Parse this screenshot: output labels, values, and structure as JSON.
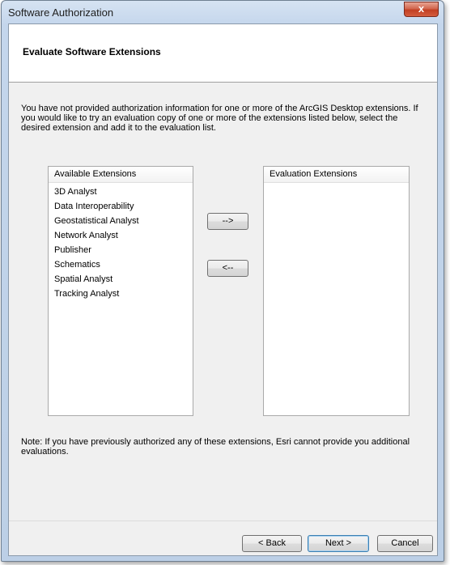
{
  "window": {
    "title": "Software Authorization",
    "close_glyph": "x"
  },
  "header": {
    "title": "Evaluate Software Extensions"
  },
  "intro_text": "You have not provided authorization information for one or more of the ArcGIS Desktop extensions.  If you would like to try an evaluation copy of one or more of the extensions listed below, select the desired extension and add it to the evaluation list.",
  "available": {
    "header": "Available Extensions",
    "items": [
      "3D Analyst",
      "Data Interoperability",
      "Geostatistical Analyst",
      "Network Analyst",
      "Publisher",
      "Schematics",
      "Spatial Analyst",
      "Tracking Analyst"
    ]
  },
  "evaluation": {
    "header": "Evaluation Extensions",
    "items": []
  },
  "transfer": {
    "add_label": "-->",
    "remove_label": "<--"
  },
  "note_text": "Note:  If you have previously authorized any of these extensions, Esri cannot provide you additional evaluations.",
  "footer": {
    "back_label": "< Back",
    "next_label": "Next >",
    "cancel_label": "Cancel"
  }
}
